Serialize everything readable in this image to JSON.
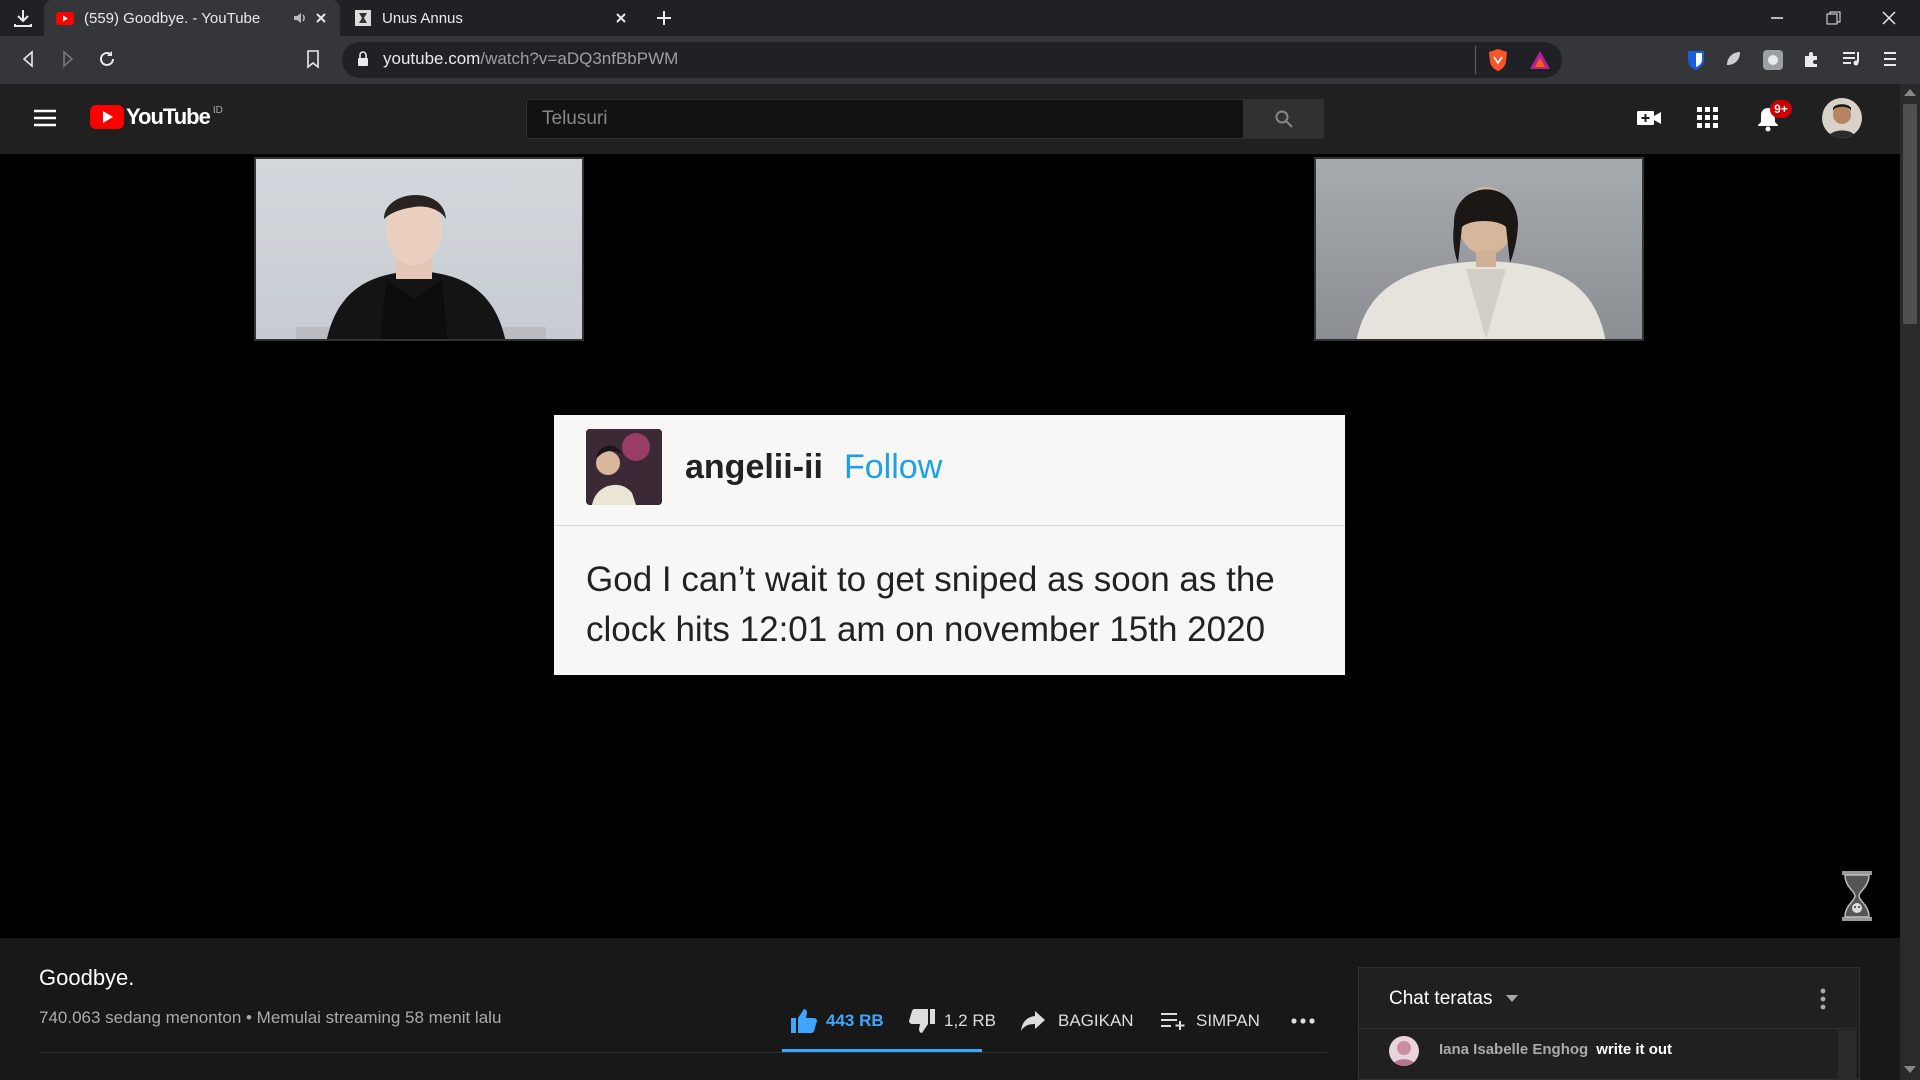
{
  "browser": {
    "tabs": [
      {
        "title": "(559) Goodbye. - YouTube",
        "active": true
      },
      {
        "title": "Unus Annus",
        "active": false
      }
    ],
    "url_domain": "youtube.com",
    "url_path": "/watch?v=aDQ3nfBbPWM"
  },
  "youtube": {
    "logo_text": "YouTube",
    "region": "ID",
    "search_placeholder": "Telusuri",
    "notifications_badge": "9+"
  },
  "video_overlay": {
    "post_username": "angelii-ii",
    "post_follow": "Follow",
    "post_text": "God I can’t wait to get sniped as soon as the clock hits 12:01 am on november 15th 2020"
  },
  "video_info": {
    "title": "Goodbye.",
    "meta": "740.063 sedang menonton • Memulai streaming 58 menit lalu",
    "likes": "443 RB",
    "dislikes": "1,2 RB",
    "share_label": "BAGIKAN",
    "save_label": "SIMPAN",
    "like_ratio": 0.997
  },
  "chat": {
    "title": "Chat teratas",
    "messages": [
      {
        "author": "Iana Isabelle Enghog",
        "text": "write it out"
      }
    ]
  },
  "colors": {
    "youtube_red": "#ff0000",
    "like_blue": "#3ea6ff",
    "follow_blue": "#1ea1e0",
    "badge_red": "#cc0000"
  }
}
